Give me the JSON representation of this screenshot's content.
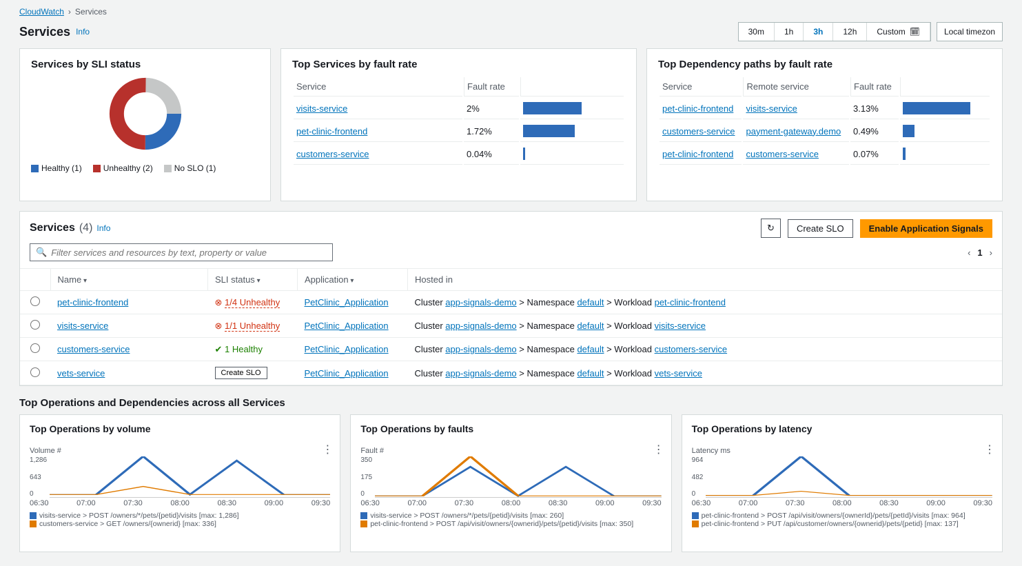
{
  "breadcrumb": {
    "root": "CloudWatch",
    "current": "Services"
  },
  "page": {
    "title": "Services",
    "info": "Info"
  },
  "time_range": {
    "options": [
      "30m",
      "1h",
      "3h",
      "12h"
    ],
    "active": "3h",
    "custom": "Custom",
    "tz": "Local timezon"
  },
  "sli_panel": {
    "title": "Services by SLI status",
    "legend": {
      "healthy": "Healthy (1)",
      "unhealthy": "Unhealthy (2)",
      "noslo": "No SLO (1)"
    }
  },
  "top_services_fault": {
    "title": "Top Services by fault rate",
    "cols": {
      "service": "Service",
      "rate": "Fault rate"
    },
    "rows": [
      {
        "service": "visits-service",
        "rate": "2%",
        "bar": 60
      },
      {
        "service": "pet-clinic-frontend",
        "rate": "1.72%",
        "bar": 53
      },
      {
        "service": "customers-service",
        "rate": "0.04%",
        "bar": 2
      }
    ]
  },
  "top_dep_fault": {
    "title": "Top Dependency paths by fault rate",
    "cols": {
      "service": "Service",
      "remote": "Remote service",
      "rate": "Fault rate"
    },
    "rows": [
      {
        "service": "pet-clinic-frontend",
        "remote": "visits-service",
        "rate": "3.13%",
        "bar": 80
      },
      {
        "service": "customers-service",
        "remote": "payment-gateway.demo",
        "rate": "0.49%",
        "bar": 14
      },
      {
        "service": "pet-clinic-frontend",
        "remote": "customers-service",
        "rate": "0.07%",
        "bar": 3
      }
    ]
  },
  "services_list": {
    "title": "Services",
    "count": "(4)",
    "info": "Info",
    "refresh_icon": "↻",
    "create_slo": "Create SLO",
    "enable_btn": "Enable Application Signals",
    "filter_placeholder": "Filter services and resources by text, property or value",
    "page": "1",
    "cols": {
      "name": "Name",
      "sli": "SLI status",
      "app": "Application",
      "hosted": "Hosted in"
    },
    "rows": [
      {
        "name": "pet-clinic-frontend",
        "sli_kind": "bad",
        "sli_text": "1/4 Unhealthy",
        "app": "PetClinic_Application",
        "cluster": "app-signals-demo",
        "ns": "default",
        "workload": "pet-clinic-frontend"
      },
      {
        "name": "visits-service",
        "sli_kind": "bad",
        "sli_text": "1/1 Unhealthy",
        "app": "PetClinic_Application",
        "cluster": "app-signals-demo",
        "ns": "default",
        "workload": "visits-service"
      },
      {
        "name": "customers-service",
        "sli_kind": "good",
        "sli_text": "1 Healthy",
        "app": "PetClinic_Application",
        "cluster": "app-signals-demo",
        "ns": "default",
        "workload": "customers-service"
      },
      {
        "name": "vets-service",
        "sli_kind": "none",
        "sli_text": "Create SLO",
        "app": "PetClinic_Application",
        "cluster": "app-signals-demo",
        "ns": "default",
        "workload": "vets-service"
      }
    ],
    "hosted_tpl": {
      "cluster": "Cluster ",
      "ns": " > Namespace ",
      "wl": " > Workload "
    }
  },
  "section_title": "Top Operations and Dependencies across all Services",
  "charts": [
    {
      "title": "Top Operations by volume",
      "ylabel": "Volume #",
      "ymax": "1,286",
      "ymid": "643",
      "xticks": [
        "06:30",
        "07:00",
        "07:30",
        "08:00",
        "08:30",
        "09:00",
        "09:30"
      ],
      "legend": [
        {
          "color": "#2e6bb8",
          "text": "visits-service > POST /owners/*/pets/{petid}/visits [max: 1,286]"
        },
        {
          "color": "#e07b00",
          "text": "customers-service > GET /owners/{ownerid} [max: 336]"
        }
      ]
    },
    {
      "title": "Top Operations by faults",
      "ylabel": "Fault #",
      "ymax": "350",
      "ymid": "175",
      "xticks": [
        "06:30",
        "07:00",
        "07:30",
        "08:00",
        "08:30",
        "09:00",
        "09:30"
      ],
      "legend": [
        {
          "color": "#2e6bb8",
          "text": "visits-service > POST /owners/*/pets/{petid}/visits [max: 260]"
        },
        {
          "color": "#e07b00",
          "text": "pet-clinic-frontend > POST /api/visit/owners/{ownerid}/pets/{petid}/visits [max: 350]"
        }
      ]
    },
    {
      "title": "Top Operations by latency",
      "ylabel": "Latency ms",
      "ymax": "964",
      "ymid": "482",
      "xticks": [
        "06:30",
        "07:00",
        "07:30",
        "08:00",
        "08:30",
        "09:00",
        "09:30"
      ],
      "legend": [
        {
          "color": "#2e6bb8",
          "text": "pet-clinic-frontend > POST /api/visit/owners/{ownerId}/pets/{petId}/visits [max: 964]"
        },
        {
          "color": "#e07b00",
          "text": "pet-clinic-frontend > PUT /api/customer/owners/{ownerid}/pets/{petid} [max: 137]"
        }
      ]
    }
  ],
  "chart_data": [
    {
      "type": "line",
      "title": "Top Operations by volume",
      "ylabel": "Volume #",
      "x": [
        "06:30",
        "07:00",
        "07:30",
        "08:00",
        "08:30",
        "09:00",
        "09:30"
      ],
      "ylim": [
        0,
        1286
      ],
      "series": [
        {
          "name": "visits-service > POST /owners/*/pets/{petid}/visits",
          "max": 1286,
          "values": [
            80,
            80,
            1286,
            80,
            1150,
            80,
            80
          ]
        },
        {
          "name": "customers-service > GET /owners/{ownerid}",
          "max": 336,
          "values": [
            80,
            80,
            336,
            80,
            80,
            80,
            80
          ]
        }
      ]
    },
    {
      "type": "line",
      "title": "Top Operations by faults",
      "ylabel": "Fault #",
      "x": [
        "06:30",
        "07:00",
        "07:30",
        "08:00",
        "08:30",
        "09:00",
        "09:30"
      ],
      "ylim": [
        0,
        350
      ],
      "series": [
        {
          "name": "visits-service > POST /owners/*/pets/{petid}/visits",
          "max": 260,
          "values": [
            10,
            10,
            260,
            10,
            260,
            10,
            10
          ]
        },
        {
          "name": "pet-clinic-frontend > POST /api/visit/owners/{ownerid}/pets/{petid}/visits",
          "max": 350,
          "values": [
            10,
            10,
            350,
            10,
            10,
            10,
            10
          ]
        }
      ]
    },
    {
      "type": "line",
      "title": "Top Operations by latency",
      "ylabel": "Latency ms",
      "x": [
        "06:30",
        "07:00",
        "07:30",
        "08:00",
        "08:30",
        "09:00",
        "09:30"
      ],
      "ylim": [
        0,
        964
      ],
      "series": [
        {
          "name": "pet-clinic-frontend > POST /api/visit/owners/{ownerId}/pets/{petId}/visits",
          "max": 964,
          "values": [
            40,
            40,
            964,
            40,
            40,
            40,
            40
          ]
        },
        {
          "name": "pet-clinic-frontend > PUT /api/customer/owners/{ownerid}/pets/{petid}",
          "max": 137,
          "values": [
            40,
            40,
            137,
            40,
            40,
            40,
            40
          ]
        }
      ]
    }
  ]
}
